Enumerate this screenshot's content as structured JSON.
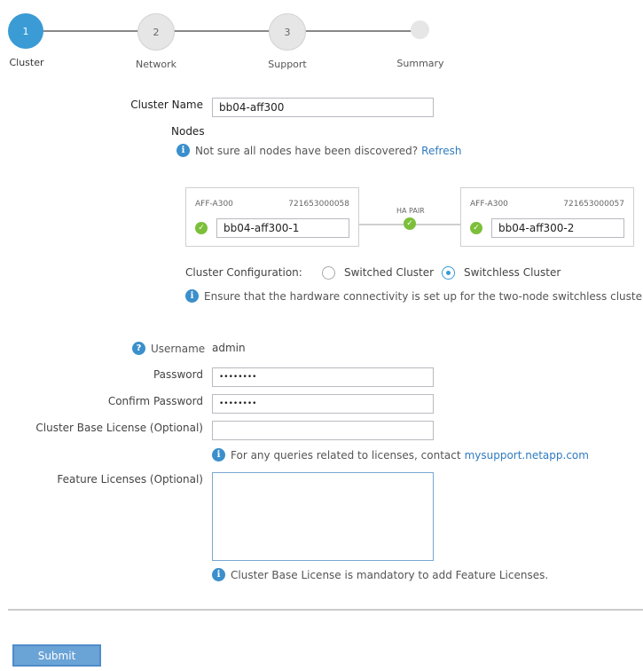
{
  "stepper": {
    "steps": [
      {
        "number": "1",
        "label": "Cluster",
        "state": "active"
      },
      {
        "number": "2",
        "label": "Network",
        "state": "todo"
      },
      {
        "number": "3",
        "label": "Support",
        "state": "todo"
      },
      {
        "number": "",
        "label": "Summary",
        "state": "todo"
      }
    ]
  },
  "cluster": {
    "name_label": "Cluster Name",
    "name_value": "bb04-aff300",
    "nodes_label": "Nodes",
    "nodes_hint": "Not sure all nodes have been discovered?",
    "refresh_link": "Refresh"
  },
  "nodes": [
    {
      "model": "AFF-A300",
      "serial": "721653000058",
      "name": "bb04-aff300-1",
      "status": "ok"
    },
    {
      "model": "AFF-A300",
      "serial": "721653000057",
      "name": "bb04-aff300-2",
      "status": "ok"
    }
  ],
  "ha_pair_label": "HA PAIR",
  "config": {
    "label": "Cluster Configuration:",
    "options": [
      "Switched Cluster",
      "Switchless Cluster"
    ],
    "selected": "Switchless Cluster",
    "hint": "Ensure that the hardware connectivity is set up for the two-node switchless cluster."
  },
  "credentials": {
    "username_label": "Username",
    "username_value": "admin",
    "password_label": "Password",
    "password_value": "••••••••",
    "confirm_label": "Confirm Password",
    "confirm_value": "••••••••",
    "base_license_label": "Cluster Base License (Optional)",
    "base_license_value": "",
    "license_hint": "For any queries related to licenses, contact",
    "license_link": "mysupport.netapp.com",
    "feature_label": "Feature Licenses (Optional)",
    "feature_value": "",
    "feature_hint": "Cluster Base License is mandatory to add Feature Licenses."
  },
  "actions": {
    "submit_label": "Submit"
  },
  "icons": {
    "info": "i",
    "help": "?",
    "check": "✓"
  },
  "colors": {
    "accent": "#3a9bd5",
    "success": "#7cbf3a",
    "link": "#2f7bbf",
    "button": "#6aa3d6"
  }
}
